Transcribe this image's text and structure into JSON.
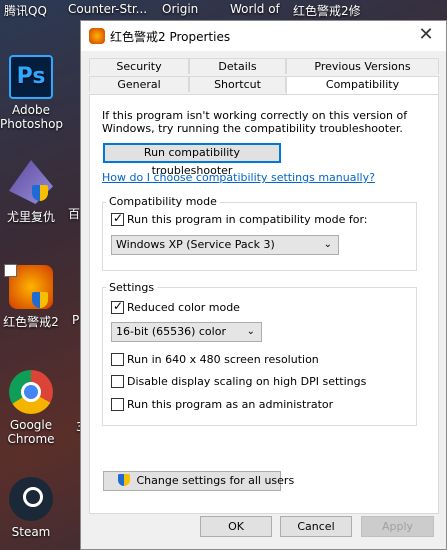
{
  "desktop": {
    "top_labels": [
      "腾讯QQ",
      "Counter-Str...",
      "Origin",
      "World of",
      "红色警戒2修"
    ],
    "icons": [
      {
        "name": "adobe-photoshop",
        "label": "Adobe Photoshop",
        "glyph": "Ps"
      },
      {
        "name": "youli-fucheng",
        "label": "尤里复仇",
        "glyph": ""
      },
      {
        "name": "red-alert-2",
        "label": "红色警戒2",
        "glyph": ""
      },
      {
        "name": "google-chrome",
        "label": "Google Chrome",
        "glyph": ""
      },
      {
        "name": "steam",
        "label": "Steam",
        "glyph": ""
      }
    ],
    "extra_texts": [
      "百",
      "P",
      "3",
      "10"
    ]
  },
  "dialog": {
    "title": "红色警戒2 Properties",
    "close_glyph": "✕",
    "tabs_row1": [
      "Security",
      "Details",
      "Previous Versions"
    ],
    "tabs_row2": [
      "General",
      "Shortcut",
      "Compatibility"
    ],
    "active_tab": "Compatibility",
    "intro_text": "If this program isn't working correctly on this version of Windows, try running the compatibility troubleshooter.",
    "troubleshooter_button": "Run compatibility troubleshooter",
    "manual_link": "How do I choose compatibility settings manually?",
    "compat_mode": {
      "group_title": "Compatibility mode",
      "checkbox_label": "Run this program in compatibility mode for:",
      "checked": true,
      "selected_os": "Windows XP (Service Pack 3)"
    },
    "settings": {
      "group_title": "Settings",
      "reduced_color": {
        "label": "Reduced color mode",
        "checked": true
      },
      "color_select": "16-bit (65536) color",
      "res_640": {
        "label": "Run in 640 x 480 screen resolution",
        "checked": false
      },
      "dpi": {
        "label": "Disable display scaling on high DPI settings",
        "checked": false
      },
      "admin": {
        "label": "Run this program as an administrator",
        "checked": false
      }
    },
    "change_all_button": "Change settings for all users",
    "ok_button": "OK",
    "cancel_button": "Cancel",
    "apply_button": "Apply",
    "colors": {
      "link": "#0066cc",
      "focus": "#0078d7"
    }
  }
}
